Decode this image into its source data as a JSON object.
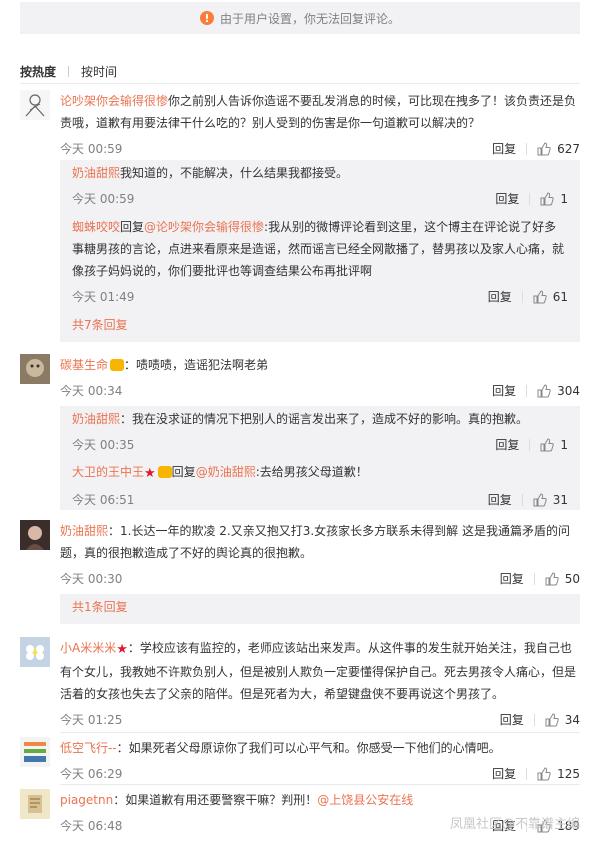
{
  "notice": {
    "text": "由于用户设置，你无法回复评论。",
    "icon": "warning-icon"
  },
  "sort": {
    "hot": "按热度",
    "time": "按时间"
  },
  "reply_label": "回复",
  "comments": [
    {
      "name": "论吵架你会输得很惨",
      "text": "你之前别人告诉你造谣不要乱发消息的时候，可比现在拽多了！该负责还是负责哦，道歉有用要法律干什么吃的？别人受到的伤害是你一句道歉可以解决的？",
      "time": "今天 00:59",
      "likes": "627",
      "replies": [
        {
          "name": "奶油甜熙",
          "text": "我知道的，不能解决，什么结果我都接受。",
          "time": "今天 00:59",
          "likes": "1"
        },
        {
          "name": "蜘蛛咬咬",
          "prefix": "回复",
          "mention": "@论吵架你会输得很惨",
          "text": ":我从别的微博评论看到这里，这个博主在评论说了好多事糖男孩的言论，点进来看原来是造谣，然而谣言已经全网散播了，替男孩以及家人心痛，就像孩子妈妈说的，你们要批评也等调查结果公布再批评啊",
          "time": "今天 01:49",
          "likes": "61"
        }
      ],
      "more": "共7条回复"
    },
    {
      "name": "碳基生命",
      "text": "：啧啧啧，造谣犯法啊老弟",
      "time": "今天 00:34",
      "likes": "304",
      "replies": [
        {
          "name": "奶油甜熙",
          "text": "：我在没求证的情况下把别人的谣言发出来了，造成不好的影响。真的抱歉。",
          "time": "今天 00:35",
          "likes": "1"
        },
        {
          "name": "大卫的王中王",
          "prefix": "回复",
          "mention": "@奶油甜熙",
          "text": ":去给男孩父母道歉！",
          "time": "今天 06:51",
          "likes": "31"
        }
      ]
    },
    {
      "name": "奶油甜熙",
      "text": "：1.长达一年的欺凌 2.又亲又抱又打3.女孩家长多方联系未得到解 这是我通篇矛盾的问题，真的很抱歉造成了不好的舆论真的很抱歉。",
      "time": "今天 00:30",
      "likes": "50",
      "more": "共1条回复"
    },
    {
      "name": "小A米米米",
      "text": "：学校应该有监控的，老师应该站出来发声。从这件事的发生就开始关注，我自己也有个女儿，我教她不许欺负别人，但是被别人欺负一定要懂得保护自己。死去男孩令人痛心，但是活着的女孩也失去了父亲的陪伴。但是死者为大，希望键盘侠不要再说这个男孩了。",
      "time": "今天 01:25",
      "likes": "34"
    },
    {
      "name": "低空飞行--",
      "text": "：如果死者父母原谅你了我们可以心平气和。你感受一下他们的心情吧。",
      "time": "今天 06:29",
      "likes": "125"
    },
    {
      "name": "piagetnn",
      "text": "：如果道歉有用还要警察干嘛？判刑！",
      "mention_after": "@上饶县公安在线",
      "time": "今天 06:48",
      "likes": "189"
    }
  ],
  "watermark": "凤凰社区@不靠谱主编",
  "colors": {
    "link": "#eb7350",
    "meta": "#808080",
    "reply_bg": "#f2f2f5"
  }
}
